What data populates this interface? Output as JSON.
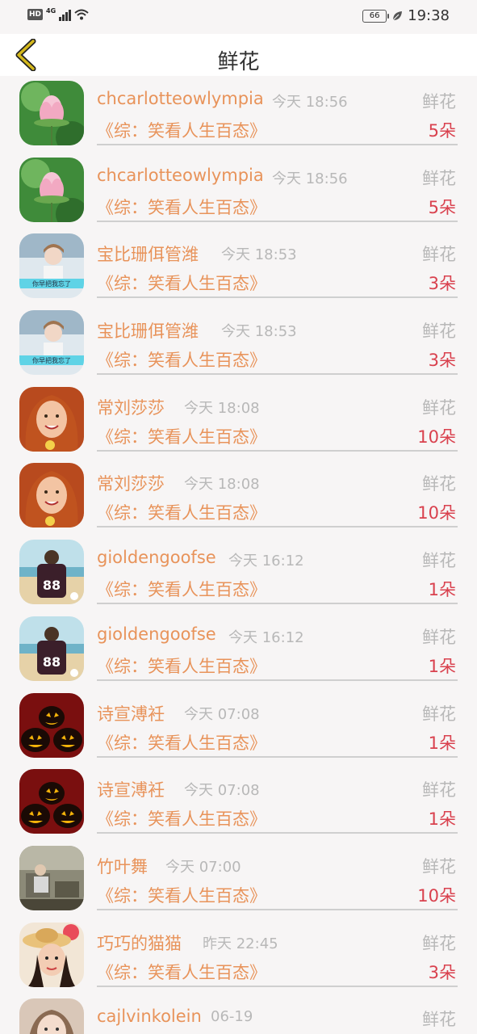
{
  "status_bar": {
    "hd_label": "HD",
    "network_label": "4G",
    "battery_level": "66",
    "time": "19:38"
  },
  "header": {
    "title": "鲜花",
    "back_icon": "chevron-left-icon"
  },
  "items": [
    {
      "name": "chcarlotteowlympia",
      "time": "今天 18:56",
      "gift": "鲜花",
      "book": "《综：笑看人生百态》",
      "count": "5朵",
      "avatar": "lotus"
    },
    {
      "name": "chcarlotteowlympia",
      "time": "今天 18:56",
      "gift": "鲜花",
      "book": "《综：笑看人生百态》",
      "count": "5朵",
      "avatar": "lotus"
    },
    {
      "name": "宝比珊佴管潍",
      "time": "今天 18:53",
      "gift": "鲜花",
      "book": "《综：笑看人生百态》",
      "count": "3朵",
      "avatar": "girl-photo",
      "avatar_caption": "你早把我忘了"
    },
    {
      "name": "宝比珊佴管潍",
      "time": "今天 18:53",
      "gift": "鲜花",
      "book": "《综：笑看人生百态》",
      "count": "3朵",
      "avatar": "girl-photo",
      "avatar_caption": "你早把我忘了"
    },
    {
      "name": "常刘莎莎",
      "time": "今天 18:08",
      "gift": "鲜花",
      "book": "《综：笑看人生百态》",
      "count": "10朵",
      "avatar": "redhead"
    },
    {
      "name": "常刘莎莎",
      "time": "今天 18:08",
      "gift": "鲜花",
      "book": "《综：笑看人生百态》",
      "count": "10朵",
      "avatar": "redhead"
    },
    {
      "name": "gioldengoofse",
      "time": "今天 16:12",
      "gift": "鲜花",
      "book": "《综：笑看人生百态》",
      "count": "1朵",
      "avatar": "beach-jersey",
      "avatar_caption": "88"
    },
    {
      "name": "gioldengoofse",
      "time": "今天 16:12",
      "gift": "鲜花",
      "book": "《综：笑看人生百态》",
      "count": "1朵",
      "avatar": "beach-jersey",
      "avatar_caption": "88"
    },
    {
      "name": "诗宣溥衽",
      "time": "今天 07:08",
      "gift": "鲜花",
      "book": "《综：笑看人生百态》",
      "count": "1朵",
      "avatar": "pumpkins"
    },
    {
      "name": "诗宣溥衽",
      "time": "今天 07:08",
      "gift": "鲜花",
      "book": "《综：笑看人生百态》",
      "count": "1朵",
      "avatar": "pumpkins"
    },
    {
      "name": "竹叶舞",
      "time": "今天 07:00",
      "gift": "鲜花",
      "book": "《综：笑看人生百态》",
      "count": "10朵",
      "avatar": "room-photo"
    },
    {
      "name": "巧巧的猫猫",
      "time": "昨天 22:45",
      "gift": "鲜花",
      "book": "《综：笑看人生百态》",
      "count": "3朵",
      "avatar": "hat-girl"
    },
    {
      "name": "cajlvinkolein",
      "time": "06-19",
      "gift": "鲜花",
      "book": "",
      "count": "",
      "avatar": "face-photo"
    }
  ],
  "colors": {
    "name": "#e8935a",
    "count": "#d9414e",
    "muted": "#b8b8b8",
    "back_arrow": "#d4b81c"
  }
}
